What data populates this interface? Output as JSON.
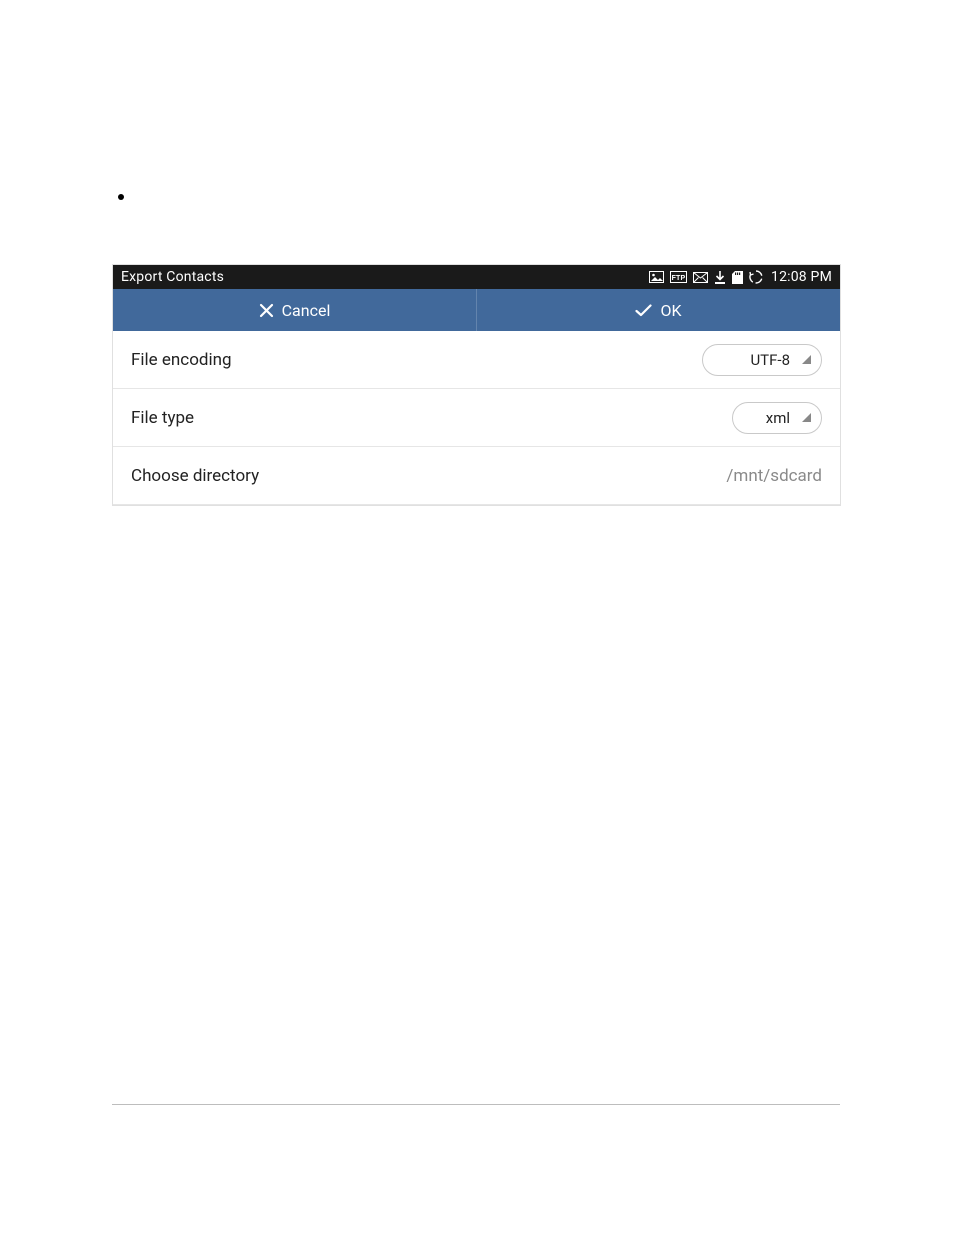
{
  "status_bar": {
    "title": "Export Contacts",
    "clock": "12:08 PM"
  },
  "action_bar": {
    "cancel_label": "Cancel",
    "ok_label": "OK"
  },
  "rows": {
    "encoding": {
      "label": "File encoding",
      "value": "UTF-8"
    },
    "filetype": {
      "label": "File type",
      "value": "xml"
    },
    "directory": {
      "label": "Choose directory",
      "value": "/mnt/sdcard"
    }
  }
}
